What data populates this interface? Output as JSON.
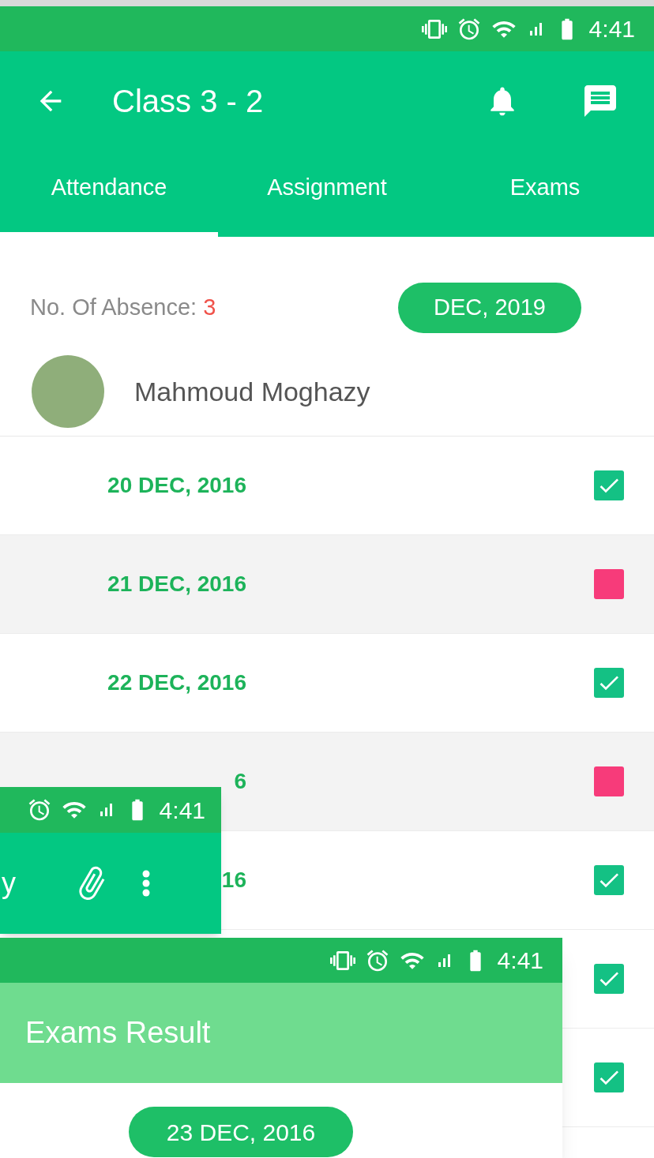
{
  "status_bar": {
    "time": "4:41"
  },
  "app_bar": {
    "title": "Class 3 - 2"
  },
  "tabs": [
    {
      "label": "Attendance",
      "selected": true
    },
    {
      "label": "Assignment",
      "selected": false
    },
    {
      "label": "Exams",
      "selected": false
    }
  ],
  "absence": {
    "label": "No. Of Absence:",
    "count": "3"
  },
  "month_button": "DEC, 2019",
  "student": {
    "name": "Mahmoud Moghazy"
  },
  "days": [
    {
      "date": "20 DEC, 2016",
      "present": true
    },
    {
      "date": "21 DEC, 2016",
      "present": false
    },
    {
      "date": "22 DEC, 2016",
      "present": true
    },
    {
      "date": "6",
      "present": false
    },
    {
      "date": "16",
      "present": true
    },
    {
      "present": true
    },
    {
      "present": true
    }
  ],
  "chat_screen": {
    "time": "4:41",
    "title": "y"
  },
  "exams_screen": {
    "time": "4:41",
    "title": "Exams Result",
    "date_button": "23 DEC, 2016"
  }
}
